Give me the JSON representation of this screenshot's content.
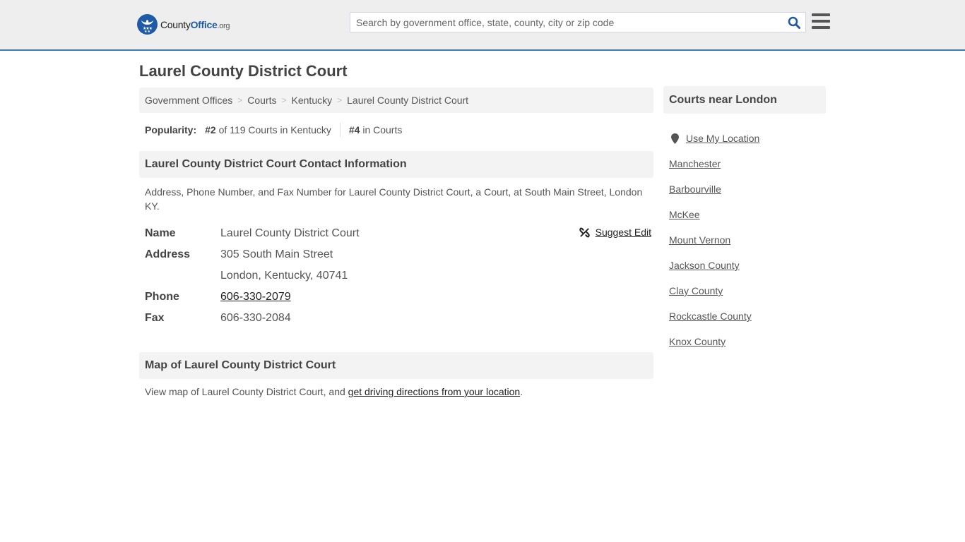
{
  "header": {
    "logo": {
      "county": "County",
      "office": "Office",
      "org": ".org"
    },
    "search_placeholder": "Search by government office, state, county, city or zip code",
    "colors": {
      "accent": "#3e7cb8",
      "brand_blue": "#1f5aa6"
    }
  },
  "page": {
    "title": "Laurel County District Court"
  },
  "breadcrumb": [
    {
      "label": "Government Offices"
    },
    {
      "label": "Courts"
    },
    {
      "label": "Kentucky"
    },
    {
      "label": "Laurel County District Court"
    }
  ],
  "breadcrumb_separator": ">",
  "popularity": {
    "label": "Popularity:",
    "state_rank": "#2",
    "state_rank_text": " of 119 Courts in Kentucky",
    "overall_rank": "#4",
    "overall_rank_text": " in Courts"
  },
  "contact": {
    "heading": "Laurel County District Court Contact Information",
    "description": "Address, Phone Number, and Fax Number for Laurel County District Court, a Court, at South Main Street, London KY.",
    "suggest_edit": "Suggest Edit",
    "fields": {
      "name_label": "Name",
      "name_value": "Laurel County District Court",
      "address_label": "Address",
      "address_line1": "305 South Main Street",
      "address_line2": "London, Kentucky, 40741",
      "phone_label": "Phone",
      "phone_value": "606-330-2079",
      "fax_label": "Fax",
      "fax_value": "606-330-2084"
    }
  },
  "map": {
    "heading": "Map of Laurel County District Court",
    "description_prefix": "View map of Laurel County District Court, and ",
    "directions_link": "get driving directions from your location",
    "description_suffix": "."
  },
  "sidebar": {
    "heading": "Courts near London",
    "use_location": "Use My Location",
    "links": [
      "Manchester",
      "Barbourville",
      "McKee",
      "Mount Vernon",
      "Jackson County",
      "Clay County",
      "Rockcastle County",
      "Knox County"
    ]
  }
}
